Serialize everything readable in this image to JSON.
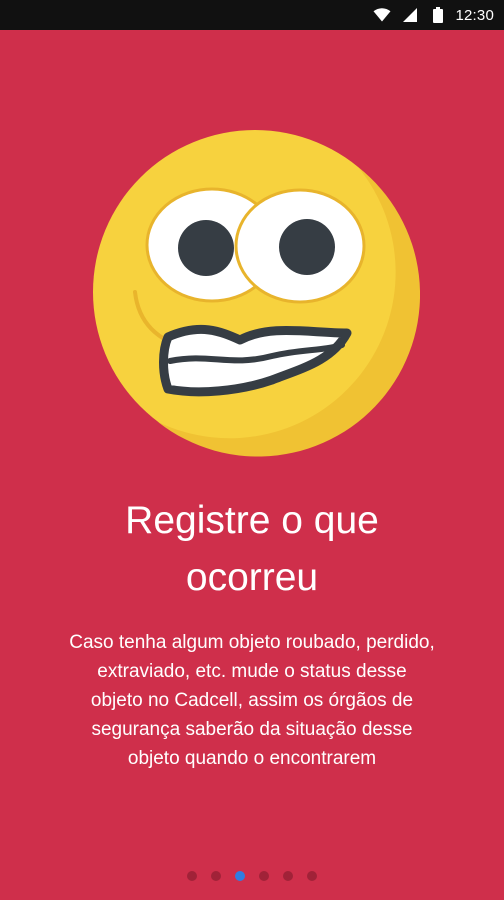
{
  "status_bar": {
    "time": "12:30",
    "icons": [
      "wifi-icon",
      "cell-signal-icon",
      "battery-icon"
    ]
  },
  "onboarding": {
    "illustration": "grimacing-face-emoji",
    "title_line1": "Registre o que",
    "title_line2": "ocorreu",
    "description_lines": [
      "Caso tenha algum objeto roubado, perdido,",
      "extraviado, etc. mude o status desse",
      "objeto no Cadcell, assim os órgãos de",
      "segurança saberão da situação desse",
      "objeto quando o encontrarem"
    ]
  },
  "pager": {
    "total_pages": 6,
    "current_page": 3
  },
  "colors": {
    "background": "#cf2f4b",
    "status_bar": "#111111",
    "dot_inactive": "#a12238",
    "dot_active": "#2f7de1",
    "emoji_face": "#f7d23e"
  }
}
